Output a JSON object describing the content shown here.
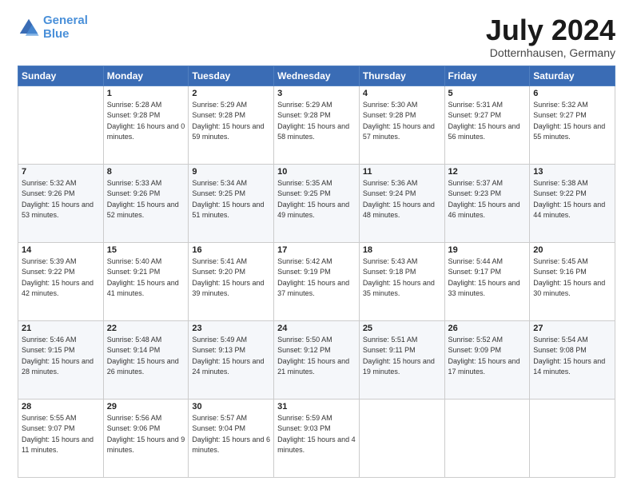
{
  "logo": {
    "text_general": "General",
    "text_blue": "Blue"
  },
  "header": {
    "month": "July 2024",
    "location": "Dotternhausen, Germany"
  },
  "weekdays": [
    "Sunday",
    "Monday",
    "Tuesday",
    "Wednesday",
    "Thursday",
    "Friday",
    "Saturday"
  ],
  "weeks": [
    [
      {
        "day": "",
        "sunrise": "",
        "sunset": "",
        "daylight": ""
      },
      {
        "day": "1",
        "sunrise": "Sunrise: 5:28 AM",
        "sunset": "Sunset: 9:28 PM",
        "daylight": "Daylight: 16 hours and 0 minutes."
      },
      {
        "day": "2",
        "sunrise": "Sunrise: 5:29 AM",
        "sunset": "Sunset: 9:28 PM",
        "daylight": "Daylight: 15 hours and 59 minutes."
      },
      {
        "day": "3",
        "sunrise": "Sunrise: 5:29 AM",
        "sunset": "Sunset: 9:28 PM",
        "daylight": "Daylight: 15 hours and 58 minutes."
      },
      {
        "day": "4",
        "sunrise": "Sunrise: 5:30 AM",
        "sunset": "Sunset: 9:28 PM",
        "daylight": "Daylight: 15 hours and 57 minutes."
      },
      {
        "day": "5",
        "sunrise": "Sunrise: 5:31 AM",
        "sunset": "Sunset: 9:27 PM",
        "daylight": "Daylight: 15 hours and 56 minutes."
      },
      {
        "day": "6",
        "sunrise": "Sunrise: 5:32 AM",
        "sunset": "Sunset: 9:27 PM",
        "daylight": "Daylight: 15 hours and 55 minutes."
      }
    ],
    [
      {
        "day": "7",
        "sunrise": "Sunrise: 5:32 AM",
        "sunset": "Sunset: 9:26 PM",
        "daylight": "Daylight: 15 hours and 53 minutes."
      },
      {
        "day": "8",
        "sunrise": "Sunrise: 5:33 AM",
        "sunset": "Sunset: 9:26 PM",
        "daylight": "Daylight: 15 hours and 52 minutes."
      },
      {
        "day": "9",
        "sunrise": "Sunrise: 5:34 AM",
        "sunset": "Sunset: 9:25 PM",
        "daylight": "Daylight: 15 hours and 51 minutes."
      },
      {
        "day": "10",
        "sunrise": "Sunrise: 5:35 AM",
        "sunset": "Sunset: 9:25 PM",
        "daylight": "Daylight: 15 hours and 49 minutes."
      },
      {
        "day": "11",
        "sunrise": "Sunrise: 5:36 AM",
        "sunset": "Sunset: 9:24 PM",
        "daylight": "Daylight: 15 hours and 48 minutes."
      },
      {
        "day": "12",
        "sunrise": "Sunrise: 5:37 AM",
        "sunset": "Sunset: 9:23 PM",
        "daylight": "Daylight: 15 hours and 46 minutes."
      },
      {
        "day": "13",
        "sunrise": "Sunrise: 5:38 AM",
        "sunset": "Sunset: 9:22 PM",
        "daylight": "Daylight: 15 hours and 44 minutes."
      }
    ],
    [
      {
        "day": "14",
        "sunrise": "Sunrise: 5:39 AM",
        "sunset": "Sunset: 9:22 PM",
        "daylight": "Daylight: 15 hours and 42 minutes."
      },
      {
        "day": "15",
        "sunrise": "Sunrise: 5:40 AM",
        "sunset": "Sunset: 9:21 PM",
        "daylight": "Daylight: 15 hours and 41 minutes."
      },
      {
        "day": "16",
        "sunrise": "Sunrise: 5:41 AM",
        "sunset": "Sunset: 9:20 PM",
        "daylight": "Daylight: 15 hours and 39 minutes."
      },
      {
        "day": "17",
        "sunrise": "Sunrise: 5:42 AM",
        "sunset": "Sunset: 9:19 PM",
        "daylight": "Daylight: 15 hours and 37 minutes."
      },
      {
        "day": "18",
        "sunrise": "Sunrise: 5:43 AM",
        "sunset": "Sunset: 9:18 PM",
        "daylight": "Daylight: 15 hours and 35 minutes."
      },
      {
        "day": "19",
        "sunrise": "Sunrise: 5:44 AM",
        "sunset": "Sunset: 9:17 PM",
        "daylight": "Daylight: 15 hours and 33 minutes."
      },
      {
        "day": "20",
        "sunrise": "Sunrise: 5:45 AM",
        "sunset": "Sunset: 9:16 PM",
        "daylight": "Daylight: 15 hours and 30 minutes."
      }
    ],
    [
      {
        "day": "21",
        "sunrise": "Sunrise: 5:46 AM",
        "sunset": "Sunset: 9:15 PM",
        "daylight": "Daylight: 15 hours and 28 minutes."
      },
      {
        "day": "22",
        "sunrise": "Sunrise: 5:48 AM",
        "sunset": "Sunset: 9:14 PM",
        "daylight": "Daylight: 15 hours and 26 minutes."
      },
      {
        "day": "23",
        "sunrise": "Sunrise: 5:49 AM",
        "sunset": "Sunset: 9:13 PM",
        "daylight": "Daylight: 15 hours and 24 minutes."
      },
      {
        "day": "24",
        "sunrise": "Sunrise: 5:50 AM",
        "sunset": "Sunset: 9:12 PM",
        "daylight": "Daylight: 15 hours and 21 minutes."
      },
      {
        "day": "25",
        "sunrise": "Sunrise: 5:51 AM",
        "sunset": "Sunset: 9:11 PM",
        "daylight": "Daylight: 15 hours and 19 minutes."
      },
      {
        "day": "26",
        "sunrise": "Sunrise: 5:52 AM",
        "sunset": "Sunset: 9:09 PM",
        "daylight": "Daylight: 15 hours and 17 minutes."
      },
      {
        "day": "27",
        "sunrise": "Sunrise: 5:54 AM",
        "sunset": "Sunset: 9:08 PM",
        "daylight": "Daylight: 15 hours and 14 minutes."
      }
    ],
    [
      {
        "day": "28",
        "sunrise": "Sunrise: 5:55 AM",
        "sunset": "Sunset: 9:07 PM",
        "daylight": "Daylight: 15 hours and 11 minutes."
      },
      {
        "day": "29",
        "sunrise": "Sunrise: 5:56 AM",
        "sunset": "Sunset: 9:06 PM",
        "daylight": "Daylight: 15 hours and 9 minutes."
      },
      {
        "day": "30",
        "sunrise": "Sunrise: 5:57 AM",
        "sunset": "Sunset: 9:04 PM",
        "daylight": "Daylight: 15 hours and 6 minutes."
      },
      {
        "day": "31",
        "sunrise": "Sunrise: 5:59 AM",
        "sunset": "Sunset: 9:03 PM",
        "daylight": "Daylight: 15 hours and 4 minutes."
      },
      {
        "day": "",
        "sunrise": "",
        "sunset": "",
        "daylight": ""
      },
      {
        "day": "",
        "sunrise": "",
        "sunset": "",
        "daylight": ""
      },
      {
        "day": "",
        "sunrise": "",
        "sunset": "",
        "daylight": ""
      }
    ]
  ]
}
